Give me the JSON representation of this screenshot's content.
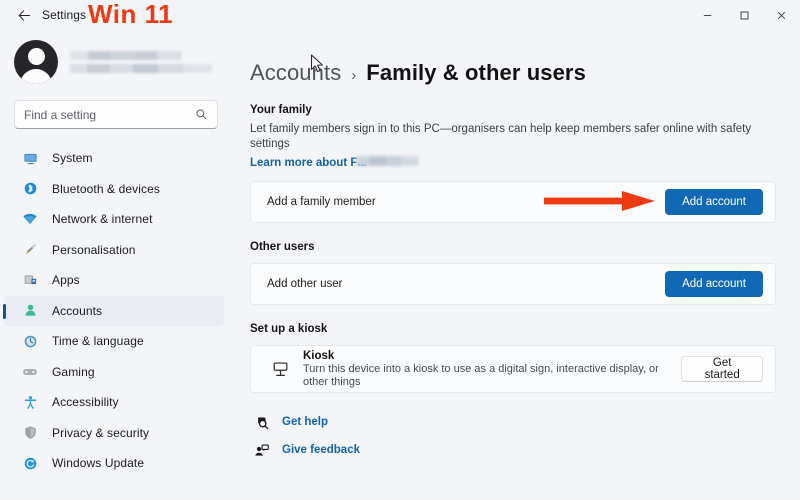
{
  "window": {
    "app_title": "Settings",
    "back_icon": "back-arrow-icon",
    "annotation": "Win 11",
    "annotation_color": "#ee3a11",
    "controls": {
      "minimize": "minimize-icon",
      "maximize": "maximize-icon",
      "close": "close-icon"
    }
  },
  "sidebar": {
    "account_name_redacted": true,
    "search": {
      "placeholder": "Find a setting",
      "value": "",
      "icon": "search-icon"
    },
    "items": [
      {
        "label": "System",
        "icon": "monitor-icon",
        "selected": false
      },
      {
        "label": "Bluetooth & devices",
        "icon": "bluetooth-icon",
        "selected": false
      },
      {
        "label": "Network & internet",
        "icon": "wifi-icon",
        "selected": false
      },
      {
        "label": "Personalisation",
        "icon": "brush-icon",
        "selected": false
      },
      {
        "label": "Apps",
        "icon": "apps-icon",
        "selected": false
      },
      {
        "label": "Accounts",
        "icon": "person-icon",
        "selected": true
      },
      {
        "label": "Time & language",
        "icon": "clock-icon",
        "selected": false
      },
      {
        "label": "Gaming",
        "icon": "gamepad-icon",
        "selected": false
      },
      {
        "label": "Accessibility",
        "icon": "accessibility-icon",
        "selected": false
      },
      {
        "label": "Privacy & security",
        "icon": "shield-icon",
        "selected": false
      },
      {
        "label": "Windows Update",
        "icon": "update-icon",
        "selected": false
      }
    ]
  },
  "main": {
    "breadcrumb": {
      "parent": "Accounts",
      "separator": "›",
      "current": "Family & other users"
    },
    "your_family": {
      "title": "Your family",
      "description": "Let family members sign in to this PC—organisers can help keep members safer online with safety settings",
      "link": "Learn more about Far",
      "link_redacted": true,
      "row": {
        "label": "Add a family member",
        "button": "Add account"
      }
    },
    "other_users": {
      "title": "Other users",
      "row": {
        "label": "Add other user",
        "button": "Add account"
      }
    },
    "kiosk": {
      "title": "Set up a kiosk",
      "card": {
        "icon": "kiosk-icon",
        "name": "Kiosk",
        "description": "Turn this device into a kiosk to use as a digital sign, interactive display, or other things",
        "button": "Get started"
      }
    },
    "footer": [
      {
        "label": "Get help",
        "icon": "help-icon"
      },
      {
        "label": "Give feedback",
        "icon": "feedback-icon"
      }
    ]
  },
  "annotations": {
    "arrow": {
      "color": "#ee3a11",
      "points_to": "Add account"
    },
    "cursor": "mouse-pointer"
  },
  "colors": {
    "accent": "#1169b5",
    "link": "#1463a8",
    "annotation_red": "#ee3a11",
    "window_bg": "#f3f5f9",
    "card_bg": "#fbfcfd"
  }
}
